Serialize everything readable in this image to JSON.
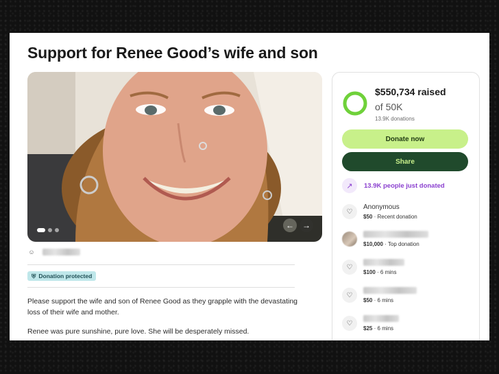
{
  "page": {
    "title": "Support for Renee Good’s wife and son"
  },
  "hero": {
    "slides": 3,
    "active_slide": 1
  },
  "donation_badge": {
    "label": "Donation protected"
  },
  "description": [
    "Please support the wife and son of Renee Good as they grapple with the devastating loss of their wife and mother.",
    "Renee was pure sunshine, pure love. She will be desperately missed."
  ],
  "summary": {
    "raised": "$550,734 raised",
    "goal": "of 50K",
    "donations_count": "13.9K donations",
    "progress": 1.0,
    "progress_color": "#6fd13a"
  },
  "buttons": {
    "donate": "Donate now",
    "share": "Share"
  },
  "trend": {
    "label": "13.9K people just donated"
  },
  "donors": [
    {
      "name": "Anonymous",
      "amount": "$50",
      "note": " · Recent donation"
    },
    {
      "name": "",
      "amount": "$10,000",
      "note": " · Top donation"
    },
    {
      "name": "",
      "amount": "$100",
      "note": " · 6 mins"
    },
    {
      "name": "",
      "amount": "$50",
      "note": " · 6 mins"
    },
    {
      "name": "",
      "amount": "$25",
      "note": " · 6 mins"
    }
  ],
  "colors": {
    "accent_green": "#c8f08a",
    "dark_green": "#204a2c",
    "purple": "#8a3fcf",
    "badge_teal": "#bfe7ea"
  },
  "icons": {
    "organizer": "person-icon",
    "badge": "shield-icon",
    "trend": "trending-up-icon",
    "donor": "heart-hand-icon",
    "prev": "arrow-left-icon",
    "next": "arrow-right-icon"
  }
}
